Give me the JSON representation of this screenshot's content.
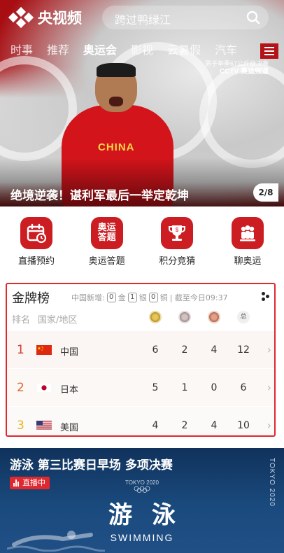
{
  "header": {
    "app_name": "央视频",
    "search_placeholder": "跨过鸭绿江",
    "tabs": [
      "时事",
      "推荐",
      "奥运会",
      "影视",
      "云暑假",
      "汽车"
    ],
    "active_tab": "奥运会",
    "brand_color": "#b31417"
  },
  "hero": {
    "caption": "绝境逆袭！谌利军最后一举定乾坤",
    "slide_counter": "2/8",
    "jersey_text": "CHINA",
    "broadcast_caption": "男子举重67公斤级决赛",
    "broadcast_logo": "CCTV 奥运频道"
  },
  "quick_actions": [
    {
      "label": "直播预约",
      "icon": "calendar-clock-icon"
    },
    {
      "label": "奥运答题",
      "icon": "quiz-icon",
      "icon_text": "奥运\n答题"
    },
    {
      "label": "积分竞猜",
      "icon": "trophy-icon"
    },
    {
      "label": "聊奥运",
      "icon": "people-chat-icon"
    }
  ],
  "medal_table": {
    "title": "金牌榜",
    "new_prefix": "中国新增:",
    "new_gold": "0",
    "gold_label": "金",
    "new_silver": "1",
    "silver_label": "银",
    "new_bronze": "0",
    "bronze_label": "铜",
    "cutoff": "| 截至今日09:37",
    "col_rank": "排名",
    "col_country": "国家/地区",
    "col_total": "总",
    "rows": [
      {
        "rank": "1",
        "country": "中国",
        "gold": "6",
        "silver": "2",
        "bronze": "4",
        "total": "12",
        "rank_color": "#d33a2c"
      },
      {
        "rank": "2",
        "country": "日本",
        "gold": "5",
        "silver": "1",
        "bronze": "0",
        "total": "6",
        "rank_color": "#e0642b"
      },
      {
        "rank": "3",
        "country": "美国",
        "gold": "4",
        "silver": "2",
        "bronze": "4",
        "total": "10",
        "rank_color": "#e6b21e"
      }
    ]
  },
  "live_card": {
    "title": "游泳 第三比赛日早场 多项决赛",
    "badge": "直播中",
    "side_text": "TOKYO 2020",
    "emblem_text": "TOKYO 2020",
    "big_title": "游泳",
    "big_subtitle": "SWIMMING"
  }
}
